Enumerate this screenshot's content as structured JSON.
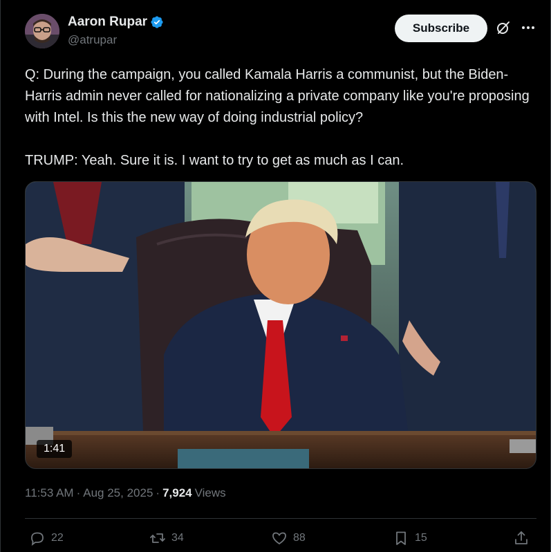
{
  "author": {
    "display_name": "Aaron Rupar",
    "handle": "@atrupar",
    "verified": true
  },
  "header": {
    "subscribe_label": "Subscribe",
    "grok_icon": "grok-icon",
    "more_icon": "more-icon"
  },
  "tweet": {
    "text": "Q: During the campaign, you called Kamala Harris a communist, but the Biden-Harris admin never called for nationalizing a private company like you're proposing with Intel. Is this the new way of doing industrial policy?\n\nTRUMP: Yeah. Sure it is. I want to try to get as much as I can."
  },
  "media": {
    "type": "video",
    "duration": "1:41"
  },
  "meta": {
    "time": "11:53 AM",
    "separator": "·",
    "date": "Aug 25, 2025",
    "views_count": "7,924",
    "views_label": "Views"
  },
  "actions": {
    "replies": "22",
    "reposts": "34",
    "likes": "88",
    "bookmarks": "15"
  },
  "colors": {
    "background": "#000000",
    "text": "#e7e9ea",
    "muted": "#71767b",
    "verified": "#1d9bf0",
    "subscribe_bg": "#eff3f4",
    "border": "#2f3336"
  }
}
